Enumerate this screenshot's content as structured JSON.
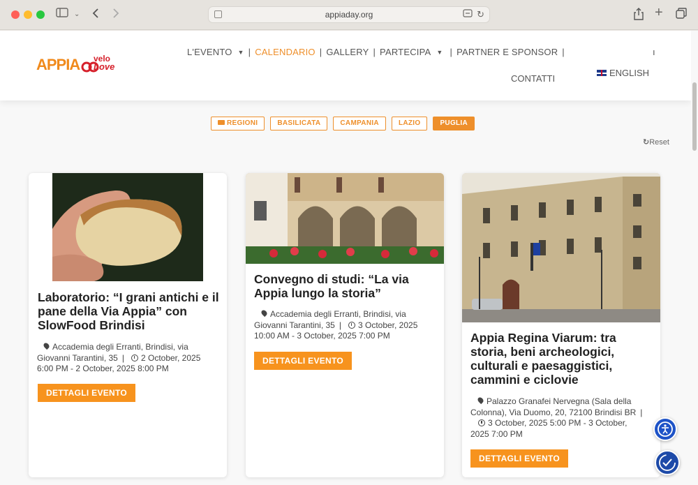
{
  "browser": {
    "url": "appiaday.org"
  },
  "nav": {
    "items": [
      {
        "label": "L'EVENTO"
      },
      {
        "label": "CALENDARIO"
      },
      {
        "label": "GALLERY"
      },
      {
        "label": "PARTECIPA"
      },
      {
        "label": "PARTNER E SPONSOR"
      },
      {
        "label": "CONTATTI"
      }
    ],
    "language": "ENGLISH"
  },
  "logo": {
    "appia": "APPIA",
    "velo": "velo",
    "love": "Love"
  },
  "filters": {
    "items": [
      "REGIONI",
      "BASILICATA",
      "CAMPANIA",
      "LAZIO",
      "PUGLIA"
    ],
    "active": "PUGLIA",
    "reset_label": "Reset"
  },
  "events": [
    {
      "title": "Laboratorio: “I grani antichi e il pane della Via Appia” con SlowFood Brindisi",
      "location_1": "Accademia degli Erranti, Brindisi, via",
      "location_2": "Giovanni Tarantini, 35",
      "date_1": "2 October, 2025",
      "date_2": "6:00 PM - 2 October, 2025 8:00 PM",
      "cta": "DETTAGLI EVENTO"
    },
    {
      "title": "Convegno di studi: “La via Appia lungo la storia”",
      "location_1": "Accademia degli Erranti, Brindisi, via",
      "location_2": "Giovanni Tarantini, 35",
      "date_1": "3 October, 2025",
      "date_2": "10:00 AM - 3 October, 2025 7:00 PM",
      "cta": "DETTAGLI EVENTO"
    },
    {
      "title": "Appia Regina Viarum: tra storia, beni archeologici, culturali e paesaggistici, cammini e ciclovie",
      "location_1": "Palazzo Granafei Nervegna (Sala della",
      "location_2": "Colonna), Via Duomo, 20, 72100 Brindisi BR",
      "date_1": "3 October, 2025 5:00 PM - 3 October,",
      "date_2": "2025 7:00 PM",
      "cta": "DETTAGLI EVENTO"
    }
  ]
}
